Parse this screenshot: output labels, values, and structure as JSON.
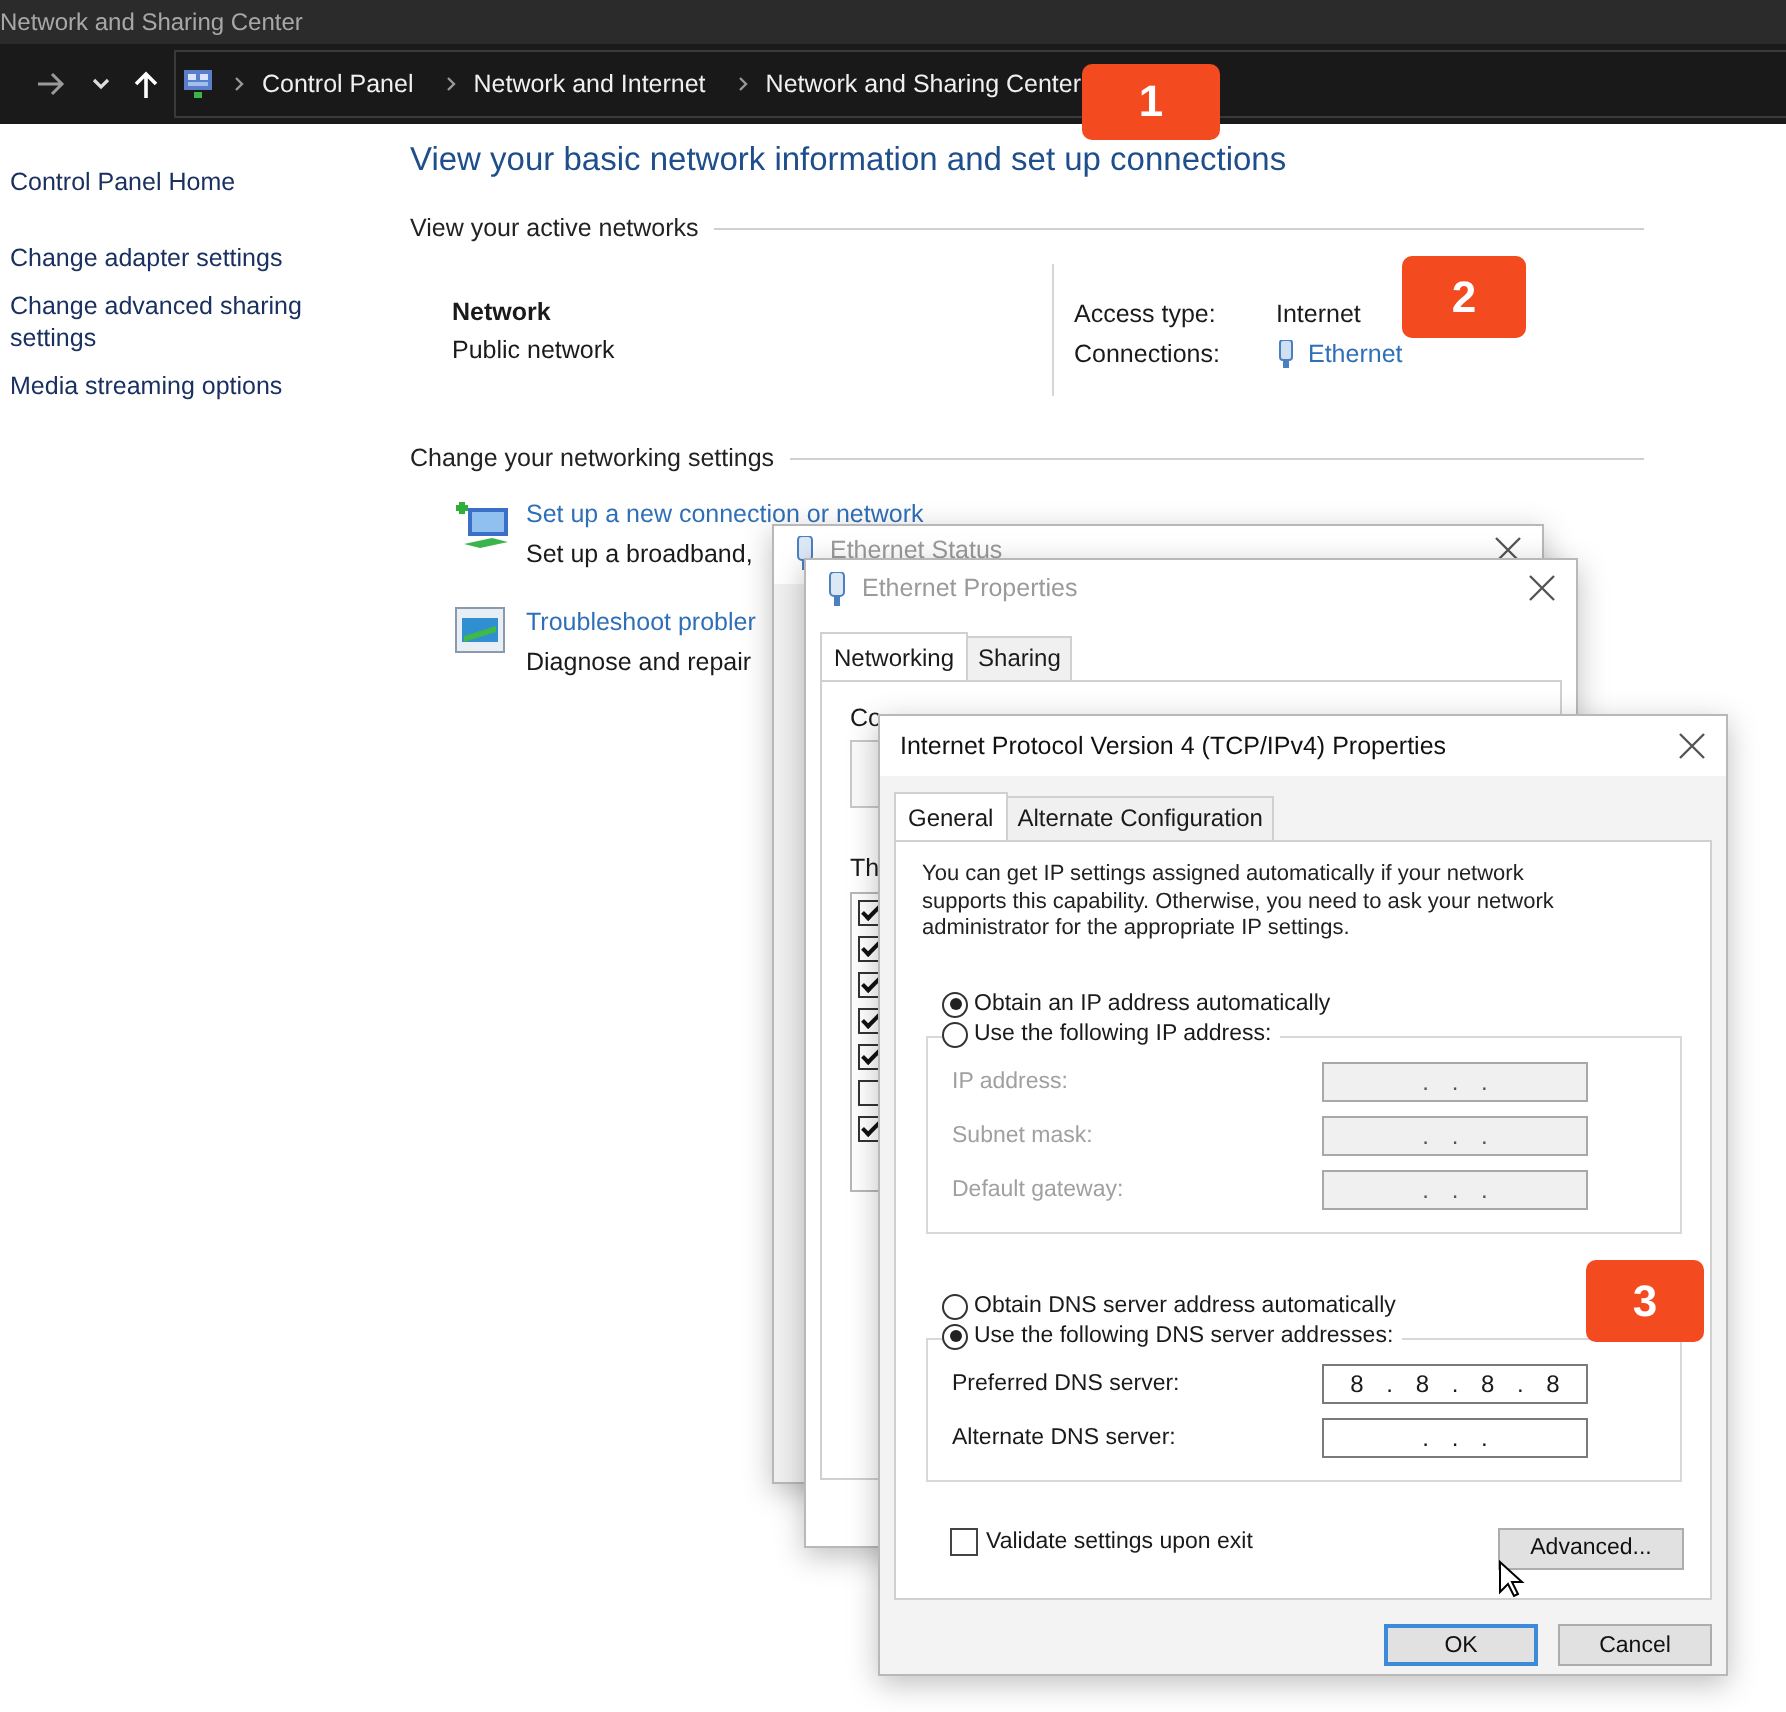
{
  "window": {
    "title": "Network and Sharing Center"
  },
  "address_bar": {
    "breadcrumbs": [
      "Control Panel",
      "Network and Internet",
      "Network and Sharing Center"
    ]
  },
  "sidebar": {
    "items": [
      "Control Panel Home",
      "Change adapter settings",
      "Change advanced sharing settings",
      "Media streaming options"
    ]
  },
  "main": {
    "heading": "View your basic network information and set up connections",
    "active_networks": {
      "title": "View your active networks",
      "network_name": "Network",
      "network_type": "Public network",
      "access_type_label": "Access type:",
      "access_type": "Internet",
      "connections_label": "Connections:",
      "connection": "Ethernet"
    },
    "settings": {
      "title": "Change your networking settings",
      "items": [
        {
          "kind": "setup",
          "link": "Set up a new connection or network",
          "description": "Set up a broadband,"
        },
        {
          "kind": "troubleshoot",
          "link": "Troubleshoot probler",
          "description": "Diagnose and repair"
        }
      ]
    }
  },
  "callouts": [
    "1",
    "2",
    "3"
  ],
  "ethernet_status": {
    "title": "Ethernet Status"
  },
  "ethernet_properties": {
    "title": "Ethernet Properties",
    "tabs": [
      {
        "label": "Networking",
        "selected": true
      },
      {
        "label": "Sharing",
        "selected": false
      }
    ],
    "connect_label": "Co",
    "items_label": "Th",
    "components": [
      {
        "checked": true
      },
      {
        "checked": true
      },
      {
        "checked": true
      },
      {
        "checked": true
      },
      {
        "checked": true
      },
      {
        "checked": false
      },
      {
        "checked": true
      }
    ]
  },
  "ipv4_dialog": {
    "title": "Internet Protocol Version 4 (TCP/IPv4) Properties",
    "tabs": [
      {
        "label": "General",
        "selected": true
      },
      {
        "label": "Alternate Configuration",
        "selected": false
      }
    ],
    "intro": "You can get IP settings assigned automatically if your network supports this capability. Otherwise, you need to ask your network administrator for the appropriate IP settings.",
    "ip_options": [
      {
        "label": "Obtain an IP address automatically",
        "selected": true
      },
      {
        "label": "Use the following IP address:",
        "selected": false
      }
    ],
    "ip_fields": [
      {
        "label": "IP address:",
        "value": ". . .",
        "disabled": true
      },
      {
        "label": "Subnet mask:",
        "value": ". . .",
        "disabled": true
      },
      {
        "label": "Default gateway:",
        "value": ". . .",
        "disabled": true
      }
    ],
    "dns_options": [
      {
        "label": "Obtain DNS server address automatically",
        "selected": false
      },
      {
        "label": "Use the following DNS server addresses:",
        "selected": true
      }
    ],
    "dns_fields": [
      {
        "label": "Preferred DNS server:",
        "value": "8 . 8 . 8 . 8",
        "disabled": false
      },
      {
        "label": "Alternate DNS server:",
        "value": ". . .",
        "disabled": false
      }
    ],
    "validate": {
      "label": "Validate settings upon exit",
      "checked": false
    },
    "advanced_button": "Advanced...",
    "buttons": [
      {
        "label": "OK",
        "kind": "default"
      },
      {
        "label": "Cancel",
        "kind": "normal"
      }
    ]
  }
}
